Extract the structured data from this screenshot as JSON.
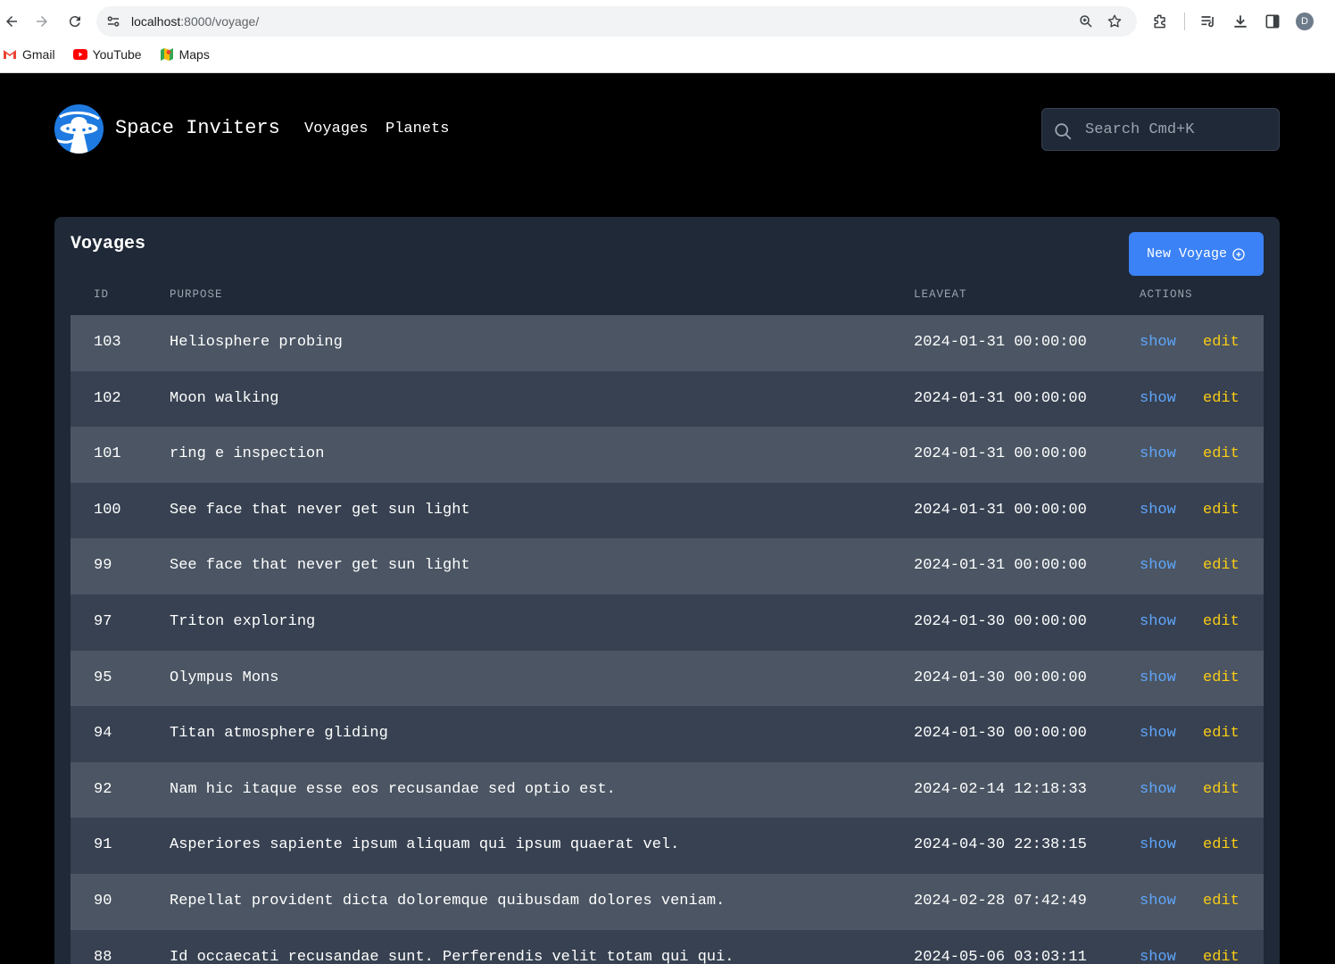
{
  "browser": {
    "url_host": "localhost",
    "url_path": ":8000/voyage/",
    "bookmarks": [
      {
        "label": "Gmail",
        "icon": "gmail-icon"
      },
      {
        "label": "YouTube",
        "icon": "youtube-icon"
      },
      {
        "label": "Maps",
        "icon": "maps-icon"
      }
    ],
    "profile_initial": "D"
  },
  "header": {
    "brand": "Space Inviters",
    "nav": [
      "Voyages",
      "Planets"
    ],
    "search_placeholder": "Search Cmd+K"
  },
  "voyages": {
    "title": "Voyages",
    "new_button": "New Voyage",
    "columns": {
      "id": "ID",
      "purpose": "PURPOSE",
      "leave_at": "LEAVEAT",
      "actions": "ACTIONS"
    },
    "show_label": "show",
    "edit_label": "edit",
    "rows": [
      {
        "id": "103",
        "purpose": "Heliosphere probing",
        "leave_at": "2024-01-31 00:00:00"
      },
      {
        "id": "102",
        "purpose": "Moon walking",
        "leave_at": "2024-01-31 00:00:00"
      },
      {
        "id": "101",
        "purpose": "ring e inspection",
        "leave_at": "2024-01-31 00:00:00"
      },
      {
        "id": "100",
        "purpose": "See face that never get sun light",
        "leave_at": "2024-01-31 00:00:00"
      },
      {
        "id": "99",
        "purpose": "See face that never get sun light",
        "leave_at": "2024-01-31 00:00:00"
      },
      {
        "id": "97",
        "purpose": "Triton exploring",
        "leave_at": "2024-01-30 00:00:00"
      },
      {
        "id": "95",
        "purpose": "Olympus Mons",
        "leave_at": "2024-01-30 00:00:00"
      },
      {
        "id": "94",
        "purpose": "Titan atmosphere gliding",
        "leave_at": "2024-01-30 00:00:00"
      },
      {
        "id": "92",
        "purpose": "Nam hic itaque esse eos recusandae sed optio est.",
        "leave_at": "2024-02-14 12:18:33"
      },
      {
        "id": "91",
        "purpose": "Asperiores sapiente ipsum aliquam qui ipsum quaerat vel.",
        "leave_at": "2024-04-30 22:38:15"
      },
      {
        "id": "90",
        "purpose": "Repellat provident dicta doloremque quibusdam dolores veniam.",
        "leave_at": "2024-02-28 07:42:49"
      },
      {
        "id": "88",
        "purpose": "Id occaecati recusandae sunt. Perferendis velit totam qui qui.",
        "leave_at": "2024-05-06 03:03:11"
      }
    ]
  },
  "colors": {
    "page_bg": "#000000",
    "card_bg": "#1f2937",
    "row_odd": "#4b5563",
    "row_even": "#374151",
    "show_link": "#60a5fa",
    "edit_link": "#facc15",
    "primary_button": "#3b82f6"
  }
}
